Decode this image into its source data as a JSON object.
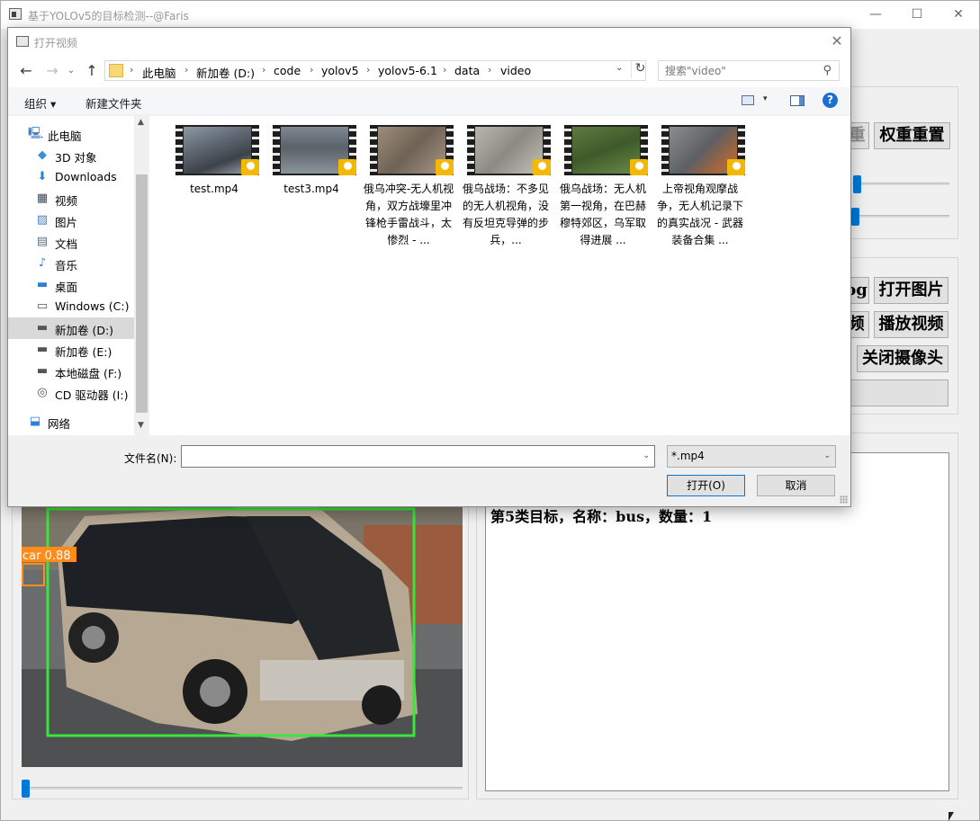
{
  "main_window": {
    "title": "基于YOLOv5的目标检测--@Faris",
    "minimize_glyph": "—",
    "maximize_glyph": "☐",
    "close_glyph": "✕",
    "buttons": {
      "weight_select_partial": "重",
      "weight_reset": "权重重置",
      "open_log_partial": "og",
      "open_image": "打开图片",
      "open_video_partial": "频",
      "play_video": "播放视频",
      "close_camera": "关闭摄像头"
    },
    "result_text": "第5类目标，名称：bus，数量：1",
    "detection_label": "car 0.88"
  },
  "dialog": {
    "title": "打开视频",
    "close_glyph": "✕",
    "nav": {
      "back": "←",
      "forward": "→",
      "recent": "⌄",
      "up": "↑"
    },
    "breadcrumb": [
      "此电脑",
      "新加卷 (D:)",
      "code",
      "yolov5",
      "yolov5-6.1",
      "data",
      "video"
    ],
    "breadcrumb_sep": "›",
    "refresh_glyph": "↻",
    "dropdown_glyph": "⌄",
    "search_placeholder": "搜索\"video\"",
    "search_glyph": "⚲",
    "toolbar": {
      "organize": "组织 ▾",
      "new_folder": "新建文件夹",
      "view_dropdown": "▾",
      "help": "?"
    },
    "nav_items": [
      {
        "label": "此电脑",
        "icon": "computer-icon",
        "glyph": "🖳",
        "color": "#4a7fbf"
      },
      {
        "label": "3D 对象",
        "icon": "cube-3d-icon",
        "glyph": "◆",
        "color": "#3d8ee0"
      },
      {
        "label": "Downloads",
        "icon": "download-icon",
        "glyph": "⬇",
        "color": "#2f7fd8"
      },
      {
        "label": "视频",
        "icon": "video-folder-icon",
        "glyph": "▦",
        "color": "#3a4a5a"
      },
      {
        "label": "图片",
        "icon": "pictures-icon",
        "glyph": "▨",
        "color": "#4a7fbf"
      },
      {
        "label": "文档",
        "icon": "documents-icon",
        "glyph": "▤",
        "color": "#5a6f88"
      },
      {
        "label": "音乐",
        "icon": "music-icon",
        "glyph": "♪",
        "color": "#2f7fd8"
      },
      {
        "label": "桌面",
        "icon": "desktop-icon",
        "glyph": "▬",
        "color": "#2f7fd8"
      },
      {
        "label": "Windows (C:)",
        "icon": "windows-drive-icon",
        "glyph": "▭",
        "color": "#555"
      },
      {
        "label": "新加卷 (D:)",
        "icon": "drive-icon",
        "glyph": "▬",
        "color": "#555"
      },
      {
        "label": "新加卷 (E:)",
        "icon": "drive-icon",
        "glyph": "▬",
        "color": "#555"
      },
      {
        "label": "本地磁盘 (F:)",
        "icon": "drive-icon",
        "glyph": "▬",
        "color": "#555"
      },
      {
        "label": "CD 驱动器 (I:)",
        "icon": "cd-drive-icon",
        "glyph": "◎",
        "color": "#555"
      },
      {
        "label": "网络",
        "icon": "network-icon",
        "glyph": "⬓",
        "color": "#2f7fd8"
      }
    ],
    "scroll_up": "▲",
    "scroll_down": "▼",
    "files": [
      {
        "name": "test.mp4",
        "thumb": "linear-gradient(160deg,#8c98a3 0%,#5d6670 40%,#3d4249 70%,#9aa2aa 100%)"
      },
      {
        "name": "test3.mp4",
        "thumb": "linear-gradient(180deg,#7e8792 0%,#5a6169 45%,#8b939b 100%)"
      },
      {
        "name": "俄乌冲突-无人机视角，双方战壕里冲锋枪手雷战斗，太惨烈 - ...",
        "thumb": "linear-gradient(135deg,#9c8c7a 0%,#6f6355 50%,#a5988a 100%)"
      },
      {
        "name": "俄乌战场：不多见的无人机视角，没有反坦克导弹的步兵，...",
        "thumb": "linear-gradient(135deg,#b9b5ae 0%,#8d8a84 50%,#c4c0ba 100%)"
      },
      {
        "name": "俄乌战场：无人机第一视角，在巴赫穆特郊区，乌军取得进展 ...",
        "thumb": "linear-gradient(160deg,#5f7a3f 0%,#3f5a2a 50%,#6b8a4a 100%)"
      },
      {
        "name": "上帝视角观摩战争，无人机记录下的真实战况 - 武器装备合集 ...",
        "thumb": "linear-gradient(135deg,#8a8d90 0%,#5d6063 50%,#a8663a 80%,#7a7d80 100%)"
      }
    ],
    "filename_label": "文件名(N):",
    "filename_value": "",
    "filter_value": "*.mp4",
    "open_button": "打开(O)",
    "cancel_button": "取消"
  }
}
